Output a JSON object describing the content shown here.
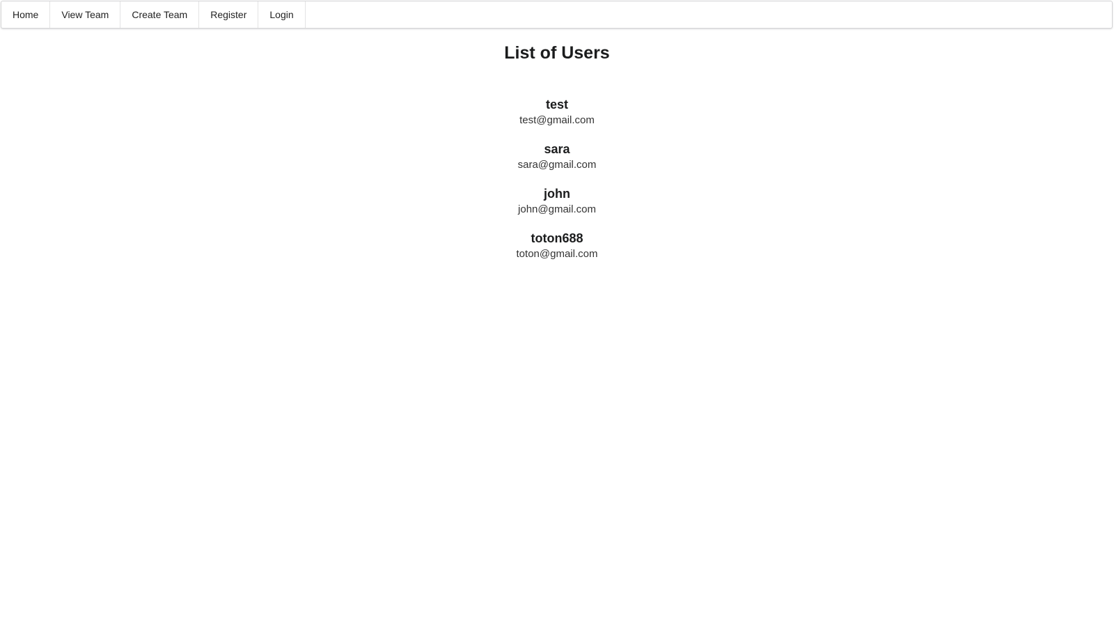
{
  "nav": {
    "items": [
      {
        "label": "Home"
      },
      {
        "label": "View Team"
      },
      {
        "label": "Create Team"
      },
      {
        "label": "Register"
      },
      {
        "label": "Login"
      }
    ]
  },
  "page": {
    "title": "List of Users"
  },
  "users": [
    {
      "name": "test",
      "email": "test@gmail.com"
    },
    {
      "name": "sara",
      "email": "sara@gmail.com"
    },
    {
      "name": "john",
      "email": "john@gmail.com"
    },
    {
      "name": "toton688",
      "email": "toton@gmail.com"
    }
  ]
}
